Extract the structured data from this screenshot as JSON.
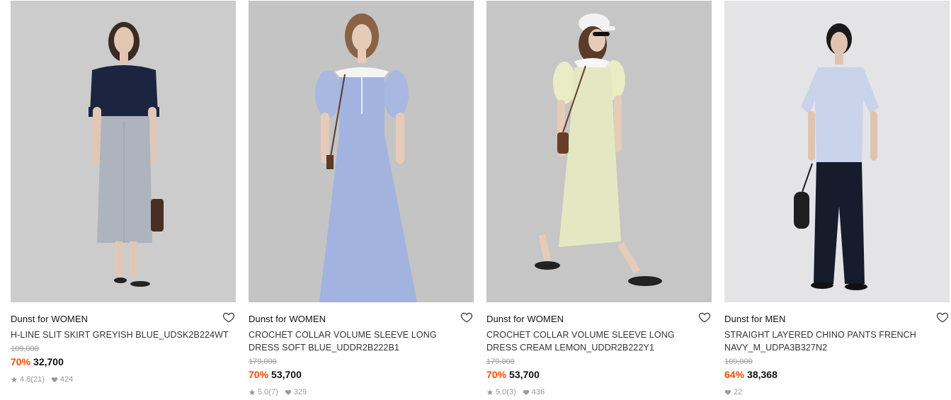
{
  "products": [
    {
      "brand": "Dunst for WOMEN",
      "name": "H-LINE SLIT SKIRT GREYISH BLUE_UDSK2B224WT",
      "original_price": "109,000",
      "discount": "70%",
      "price": "32,700",
      "rating": "4.8",
      "reviews": "(21)",
      "likes": "424",
      "colors": {
        "bg": "#c9c9c9",
        "top": "#1c2540",
        "bottom": "#aeb4bd",
        "skin": "#e2c6b4",
        "hair": "#3a2a22",
        "bag": "#4a2e24"
      }
    },
    {
      "brand": "Dunst for WOMEN",
      "name": "CROCHET COLLAR VOLUME SLEEVE LONG DRESS SOFT BLUE_UDDR2B222B1",
      "original_price": "179,000",
      "discount": "70%",
      "price": "53,700",
      "rating": "5.0",
      "reviews": "(7)",
      "likes": "329",
      "colors": {
        "bg": "#c4c4c4",
        "top": "#a9b8e0",
        "bottom": "#a3b3df",
        "skin": "#e6cbb8",
        "hair": "#8a6244",
        "bag": "#5a3a2a"
      }
    },
    {
      "brand": "Dunst for WOMEN",
      "name": "CROCHET COLLAR VOLUME SLEEVE LONG DRESS CREAM LEMON_UDDR2B222Y1",
      "original_price": "179,000",
      "discount": "70%",
      "price": "53,700",
      "rating": "5.0",
      "reviews": "(3)",
      "likes": "436",
      "colors": {
        "bg": "#c6c6c6",
        "top": "#e9ecc4",
        "bottom": "#e4e8c2",
        "skin": "#e6cbb8",
        "hair": "#5a3a28",
        "bag": "#6a3e26"
      }
    },
    {
      "brand": "Dunst for MEN",
      "name": "STRAIGHT LAYERED CHINO PANTS FRENCH NAVY_M_UDPA3B327N2",
      "original_price": "109,000",
      "discount": "64%",
      "price": "38,368",
      "rating": "",
      "reviews": "",
      "likes": "22",
      "colors": {
        "bg": "#e4e4e6",
        "top": "#c9d3ea",
        "bottom": "#161c2c",
        "skin": "#e0c4b0",
        "hair": "#1a1a1a",
        "bag": "#1e1e1e"
      }
    }
  ],
  "icons": {
    "wishlist": "heart-outline-icon",
    "star": "star-icon",
    "likes": "heart-filled-icon"
  }
}
